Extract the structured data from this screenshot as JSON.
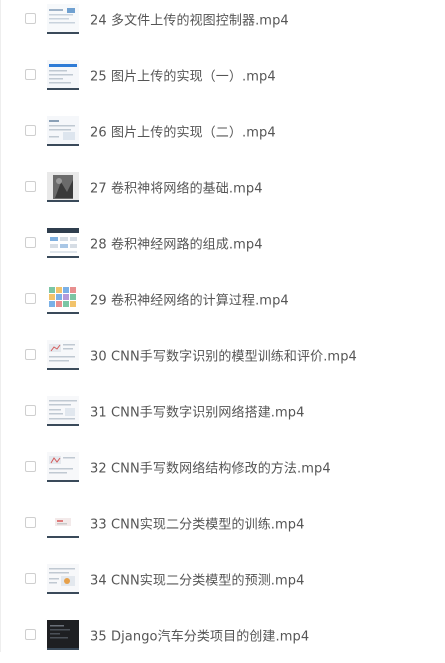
{
  "files": [
    {
      "name": "24 多文件上传的视图控制器.mp4",
      "thumb": "doc-thumbnail-icon"
    },
    {
      "name": "25 图片上传的实现（一）.mp4",
      "thumb": "doc-thumbnail-icon"
    },
    {
      "name": "26 图片上传的实现（二）.mp4",
      "thumb": "doc-thumbnail-icon"
    },
    {
      "name": "27 卷积神将网络的基础.mp4",
      "thumb": "photo-thumbnail-icon"
    },
    {
      "name": "28 卷积神经网路的组成.mp4",
      "thumb": "table-thumbnail-icon"
    },
    {
      "name": "29 卷积神经网络的计算过程.mp4",
      "thumb": "grid-thumbnail-icon"
    },
    {
      "name": "30 CNN手写数字识别的模型训练和评价.mp4",
      "thumb": "doc-thumbnail-icon"
    },
    {
      "name": "31 CNN手写数字识别网络搭建.mp4",
      "thumb": "doc-thumbnail-icon"
    },
    {
      "name": "32 CNN手写数网络结构修改的方法.mp4",
      "thumb": "doc-thumbnail-icon"
    },
    {
      "name": "33 CNN实现二分类模型的训练.mp4",
      "thumb": "doc-thumbnail-icon"
    },
    {
      "name": "34 CNN实现二分类模型的预测.mp4",
      "thumb": "doc-thumbnail-icon"
    },
    {
      "name": "35 Django汽车分类项目的创建.mp4",
      "thumb": "dark-thumbnail-icon"
    }
  ]
}
